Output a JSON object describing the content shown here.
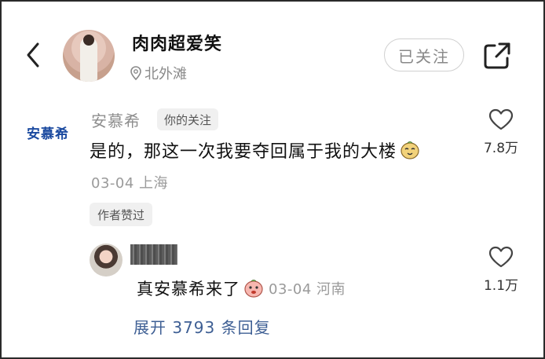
{
  "header": {
    "title": "肉肉超爱笑",
    "location": "北外滩",
    "follow_label": "已关注"
  },
  "comment": {
    "brand_logo_text": "安慕希",
    "author": "安慕希",
    "relation_tag": "你的关注",
    "text": "是的，那这一次我要夺回属于我的大楼",
    "date": "03-04",
    "region": "上海",
    "author_badge": "作者赞过",
    "likes": "7.8万"
  },
  "reply": {
    "text": "真安慕希来了",
    "date": "03-04",
    "region": "河南",
    "likes": "1.1万"
  },
  "expand_label": "展开 3793 条回复",
  "icons": {
    "back": "chevron-left-icon",
    "location": "location-pin-icon",
    "share": "share-icon",
    "like": "heart-outline-icon"
  }
}
